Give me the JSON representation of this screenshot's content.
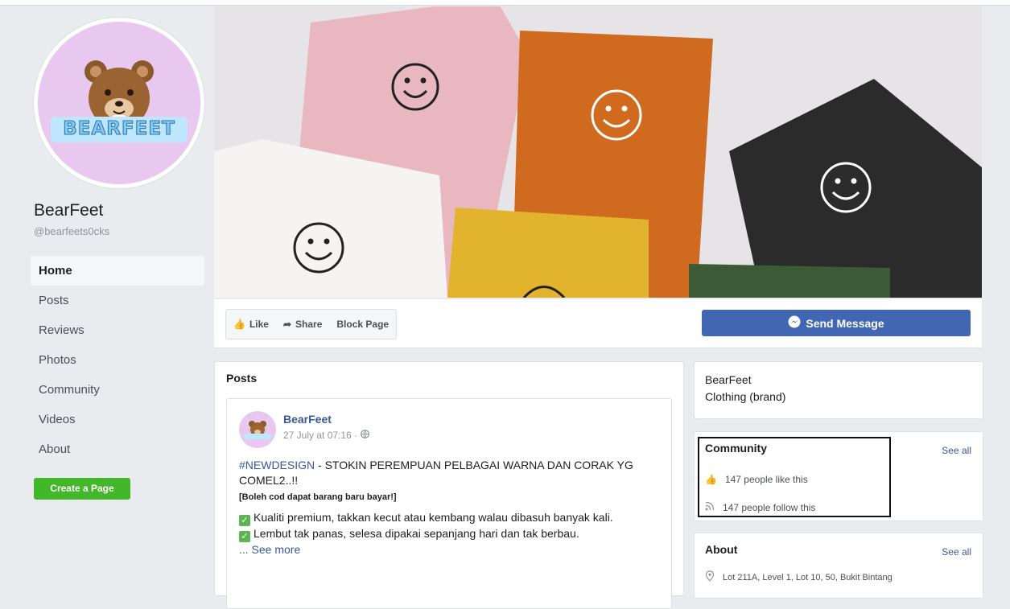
{
  "page": {
    "name": "BearFeet",
    "handle": "@bearfeets0cks",
    "logo_text": "BEARFEET"
  },
  "nav": {
    "items": [
      {
        "label": "Home",
        "active": true
      },
      {
        "label": "Posts"
      },
      {
        "label": "Reviews"
      },
      {
        "label": "Photos"
      },
      {
        "label": "Community"
      },
      {
        "label": "Videos"
      },
      {
        "label": "About"
      }
    ],
    "create_page": "Create a Page"
  },
  "actions": {
    "like": "Like",
    "share": "Share",
    "block": "Block Page",
    "send_message": "Send Message"
  },
  "posts": {
    "title": "Posts",
    "post": {
      "author": "BearFeet",
      "time": "27 July at 07:16 ·",
      "hashtag": "#NEWDESIGN",
      "headline": " - STOKIN PEREMPUAN PELBAGAI WARNA DAN CORAK YG COMEL2..!!",
      "bold_line": "[Boleh cod dapat barang baru bayar!]",
      "point1": "Kualiti premium, takkan kecut atau kembang walau dibasuh banyak kali.",
      "point2": "Lembut tak panas, selesa dipakai sepanjang hari dan tak berbau.",
      "see_more": "... See more"
    }
  },
  "info": {
    "name": "BearFeet",
    "category": "Clothing (brand)"
  },
  "community": {
    "title": "Community",
    "see_all": "See all",
    "likes": "147 people like this",
    "follows": "147 people follow this"
  },
  "about": {
    "title": "About",
    "see_all": "See all",
    "address": "Lot 211A, Level 1, Lot 10, 50, Bukit Bintang"
  },
  "colors": {
    "brand_blue": "#4267b2",
    "link_blue": "#385898",
    "green": "#42b72a",
    "avatar_pink": "#e9c8f0"
  }
}
